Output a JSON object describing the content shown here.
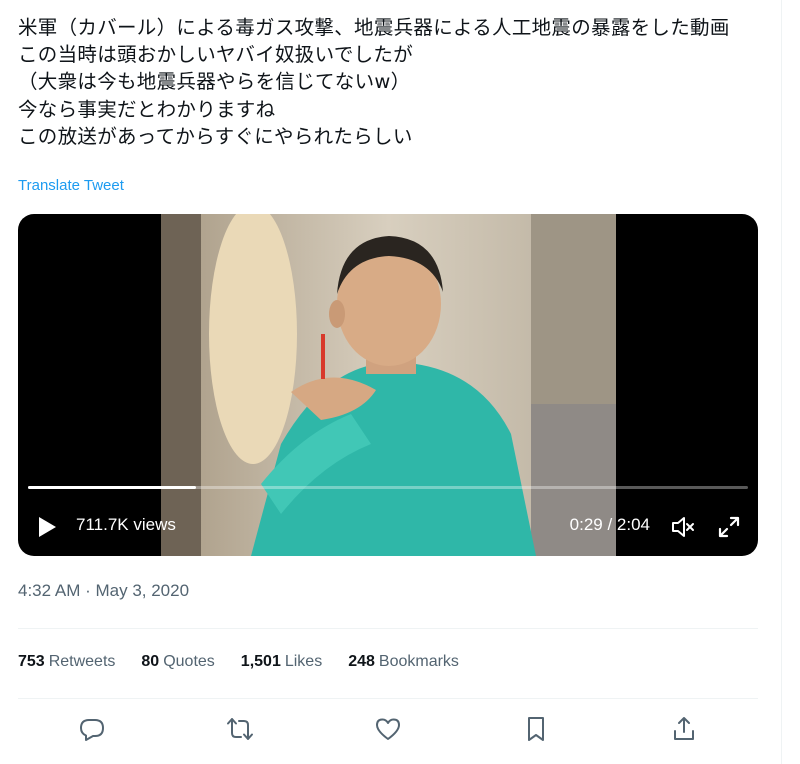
{
  "tweet": {
    "text": "米軍（カバール）による毒ガス攻撃、地震兵器による人工地震の暴露をした動画\nこの当時は頭おかしいヤバイ奴扱いでしたが\n（大衆は今も地震兵器やらを信じてないw）\n今なら事実だとわかりますね\nこの放送があってからすぐにやられたらしい",
    "translate_label": "Translate Tweet"
  },
  "video": {
    "views": "711.7K views",
    "time": "0:29 / 2:04",
    "progress": 0.234
  },
  "meta": {
    "timestamp": "4:32 AM · May 3, 2020"
  },
  "stats": {
    "retweets_count": "753",
    "retweets_label": "Retweets",
    "quotes_count": "80",
    "quotes_label": "Quotes",
    "likes_count": "1,501",
    "likes_label": "Likes",
    "bookmarks_count": "248",
    "bookmarks_label": "Bookmarks"
  },
  "actions": [
    "reply-icon",
    "retweet-icon",
    "like-icon",
    "bookmark-icon",
    "share-icon"
  ],
  "colors": {
    "link": "#1d9bf0",
    "muted": "#536471",
    "text": "#0f1419"
  }
}
